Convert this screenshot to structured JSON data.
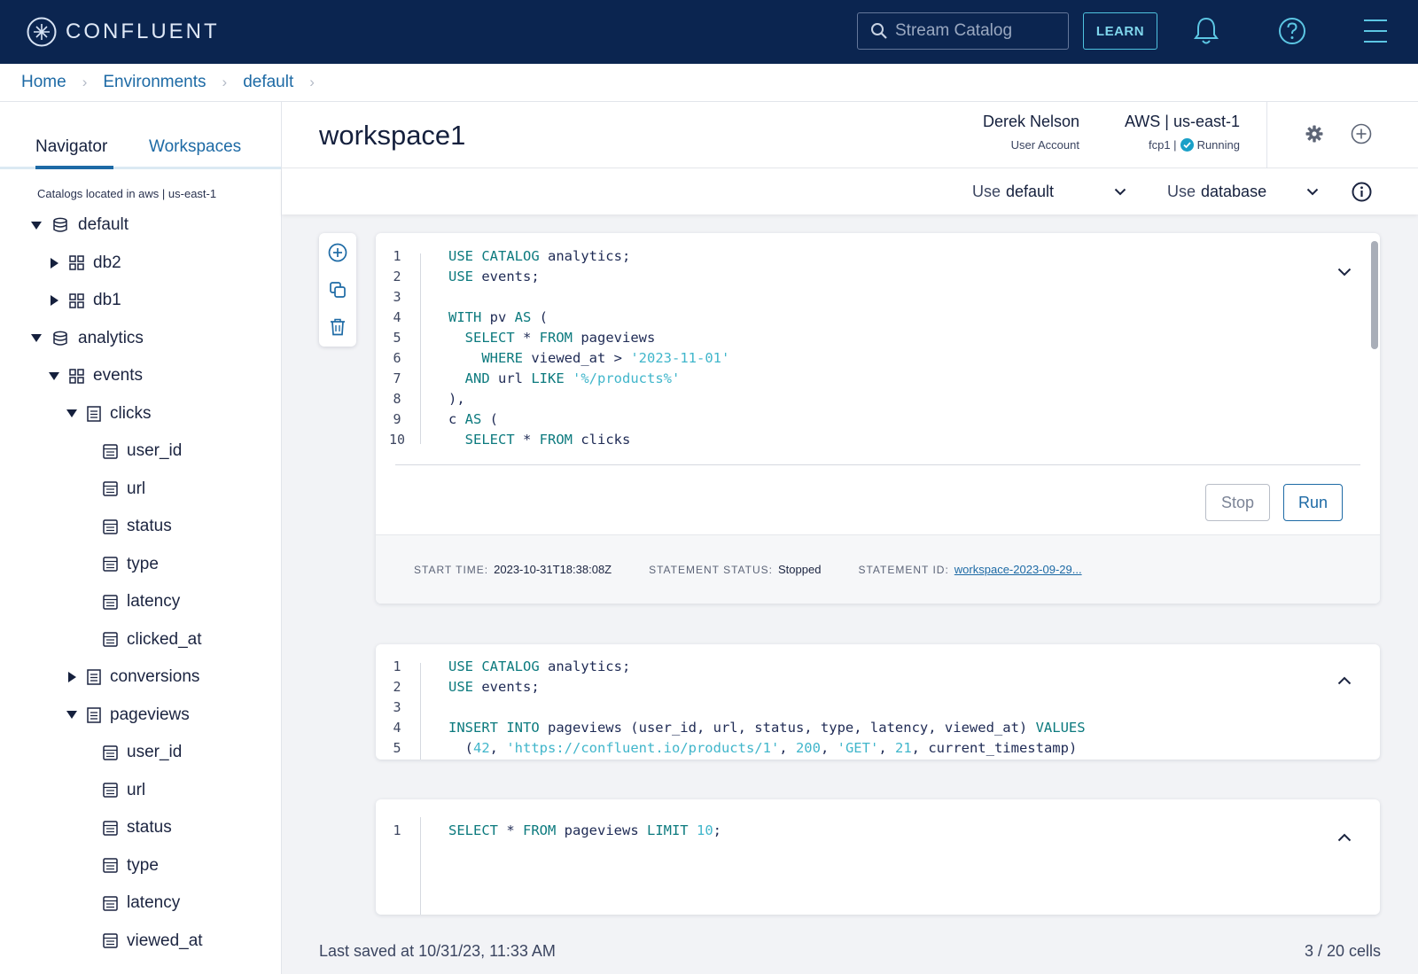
{
  "app": {
    "brand": "CONFLUENT"
  },
  "topbar": {
    "search_placeholder": "Stream Catalog",
    "learn_label": "LEARN"
  },
  "breadcrumb": [
    "Home",
    "Environments",
    "default"
  ],
  "sidebar": {
    "tabs": [
      "Navigator",
      "Workspaces"
    ],
    "active_tab": "Navigator",
    "catalog_note": "Catalogs located in aws | us-east-1",
    "tree": [
      {
        "label": "default",
        "type": "catalog",
        "expanded": true
      },
      {
        "label": "db2",
        "type": "database",
        "expanded": false
      },
      {
        "label": "db1",
        "type": "database",
        "expanded": false
      },
      {
        "label": "analytics",
        "type": "catalog",
        "expanded": true
      },
      {
        "label": "events",
        "type": "database",
        "expanded": true
      },
      {
        "label": "clicks",
        "type": "table",
        "expanded": true
      },
      {
        "label": "user_id",
        "type": "column"
      },
      {
        "label": "url",
        "type": "column"
      },
      {
        "label": "status",
        "type": "column"
      },
      {
        "label": "type",
        "type": "column"
      },
      {
        "label": "latency",
        "type": "column"
      },
      {
        "label": "clicked_at",
        "type": "column"
      },
      {
        "label": "conversions",
        "type": "table",
        "expanded": false
      },
      {
        "label": "pageviews",
        "type": "table",
        "expanded": true
      },
      {
        "label": "user_id",
        "type": "column"
      },
      {
        "label": "url",
        "type": "column"
      },
      {
        "label": "status",
        "type": "column"
      },
      {
        "label": "type",
        "type": "column"
      },
      {
        "label": "latency",
        "type": "column"
      },
      {
        "label": "viewed_at",
        "type": "column"
      }
    ]
  },
  "workspace": {
    "title": "workspace1",
    "user_name": "Derek Nelson",
    "user_role": "User Account",
    "environment": "AWS | us-east-1",
    "compute_pool": "fcp1 |",
    "compute_status": "Running"
  },
  "subbar": {
    "catalog_prefix": "Use",
    "catalog_value": "default",
    "db_prefix": "Use",
    "db_value": "database"
  },
  "cells": [
    {
      "line_numbers": [
        "1",
        "2",
        "3",
        "4",
        "5",
        "6",
        "7",
        "8",
        "9",
        "10"
      ],
      "lines": [
        [
          [
            "kw",
            "USE CATALOG"
          ],
          [
            "id",
            " analytics;"
          ]
        ],
        [
          [
            "kw",
            "USE"
          ],
          [
            "id",
            " events;"
          ]
        ],
        [],
        [
          [
            "kw",
            "WITH"
          ],
          [
            "id",
            " pv "
          ],
          [
            "kw",
            "AS"
          ],
          [
            "id",
            " ("
          ]
        ],
        [
          [
            "id",
            "  "
          ],
          [
            "kw",
            "SELECT"
          ],
          [
            "id",
            " * "
          ],
          [
            "kw",
            "FROM"
          ],
          [
            "id",
            " pageviews"
          ]
        ],
        [
          [
            "id",
            "    "
          ],
          [
            "kw",
            "WHERE"
          ],
          [
            "id",
            " viewed_at > "
          ],
          [
            "str",
            "'2023-11-01'"
          ]
        ],
        [
          [
            "id",
            "  "
          ],
          [
            "kw",
            "AND"
          ],
          [
            "id",
            " url "
          ],
          [
            "kw",
            "LIKE"
          ],
          [
            "id",
            " "
          ],
          [
            "str",
            "'%/products%'"
          ]
        ],
        [
          [
            "id",
            "),"
          ]
        ],
        [
          [
            "id",
            "c "
          ],
          [
            "kw",
            "AS"
          ],
          [
            "id",
            " ("
          ]
        ],
        [
          [
            "id",
            "  "
          ],
          [
            "kw",
            "SELECT"
          ],
          [
            "id",
            " * "
          ],
          [
            "kw",
            "FROM"
          ],
          [
            "id",
            " clicks"
          ]
        ]
      ],
      "stop_label": "Stop",
      "run_label": "Run",
      "status": {
        "start_time_label": "START TIME:",
        "start_time": "2023-10-31T18:38:08Z",
        "statement_status_label": "STATEMENT STATUS:",
        "statement_status": "Stopped",
        "statement_id_label": "STATEMENT ID:",
        "statement_id": "workspace-2023-09-29..."
      }
    },
    {
      "line_numbers": [
        "1",
        "2",
        "3",
        "4",
        "5"
      ],
      "lines": [
        [
          [
            "kw",
            "USE CATALOG"
          ],
          [
            "id",
            " analytics;"
          ]
        ],
        [
          [
            "kw",
            "USE"
          ],
          [
            "id",
            " events;"
          ]
        ],
        [],
        [
          [
            "kw",
            "INSERT INTO"
          ],
          [
            "id",
            " pageviews (user_id, url, status, type, latency, viewed_at) "
          ],
          [
            "kw",
            "VALUES"
          ]
        ],
        [
          [
            "id",
            "  ("
          ],
          [
            "num",
            "42"
          ],
          [
            "id",
            ", "
          ],
          [
            "str",
            "'https://confluent.io/products/1'"
          ],
          [
            "id",
            ", "
          ],
          [
            "num",
            "200"
          ],
          [
            "id",
            ", "
          ],
          [
            "str",
            "'GET'"
          ],
          [
            "id",
            ", "
          ],
          [
            "num",
            "21"
          ],
          [
            "id",
            ", current_timestamp)"
          ]
        ]
      ]
    },
    {
      "line_numbers": [
        "1"
      ],
      "lines": [
        [
          [
            "kw",
            "SELECT"
          ],
          [
            "id",
            " * "
          ],
          [
            "kw",
            "FROM"
          ],
          [
            "id",
            " pageviews "
          ],
          [
            "kw",
            "LIMIT"
          ],
          [
            "id",
            " "
          ],
          [
            "num",
            "10"
          ],
          [
            "id",
            ";"
          ]
        ]
      ]
    }
  ],
  "footer": {
    "last_saved": "Last saved at 10/31/23, 11:33 AM",
    "cell_count": "3 / 20 cells"
  },
  "colors": {
    "topbar": "#0b2550",
    "accent": "#1d6aa5",
    "keyword": "#0c7a7e",
    "string": "#41b6cb",
    "running": "#1aa0c8"
  }
}
